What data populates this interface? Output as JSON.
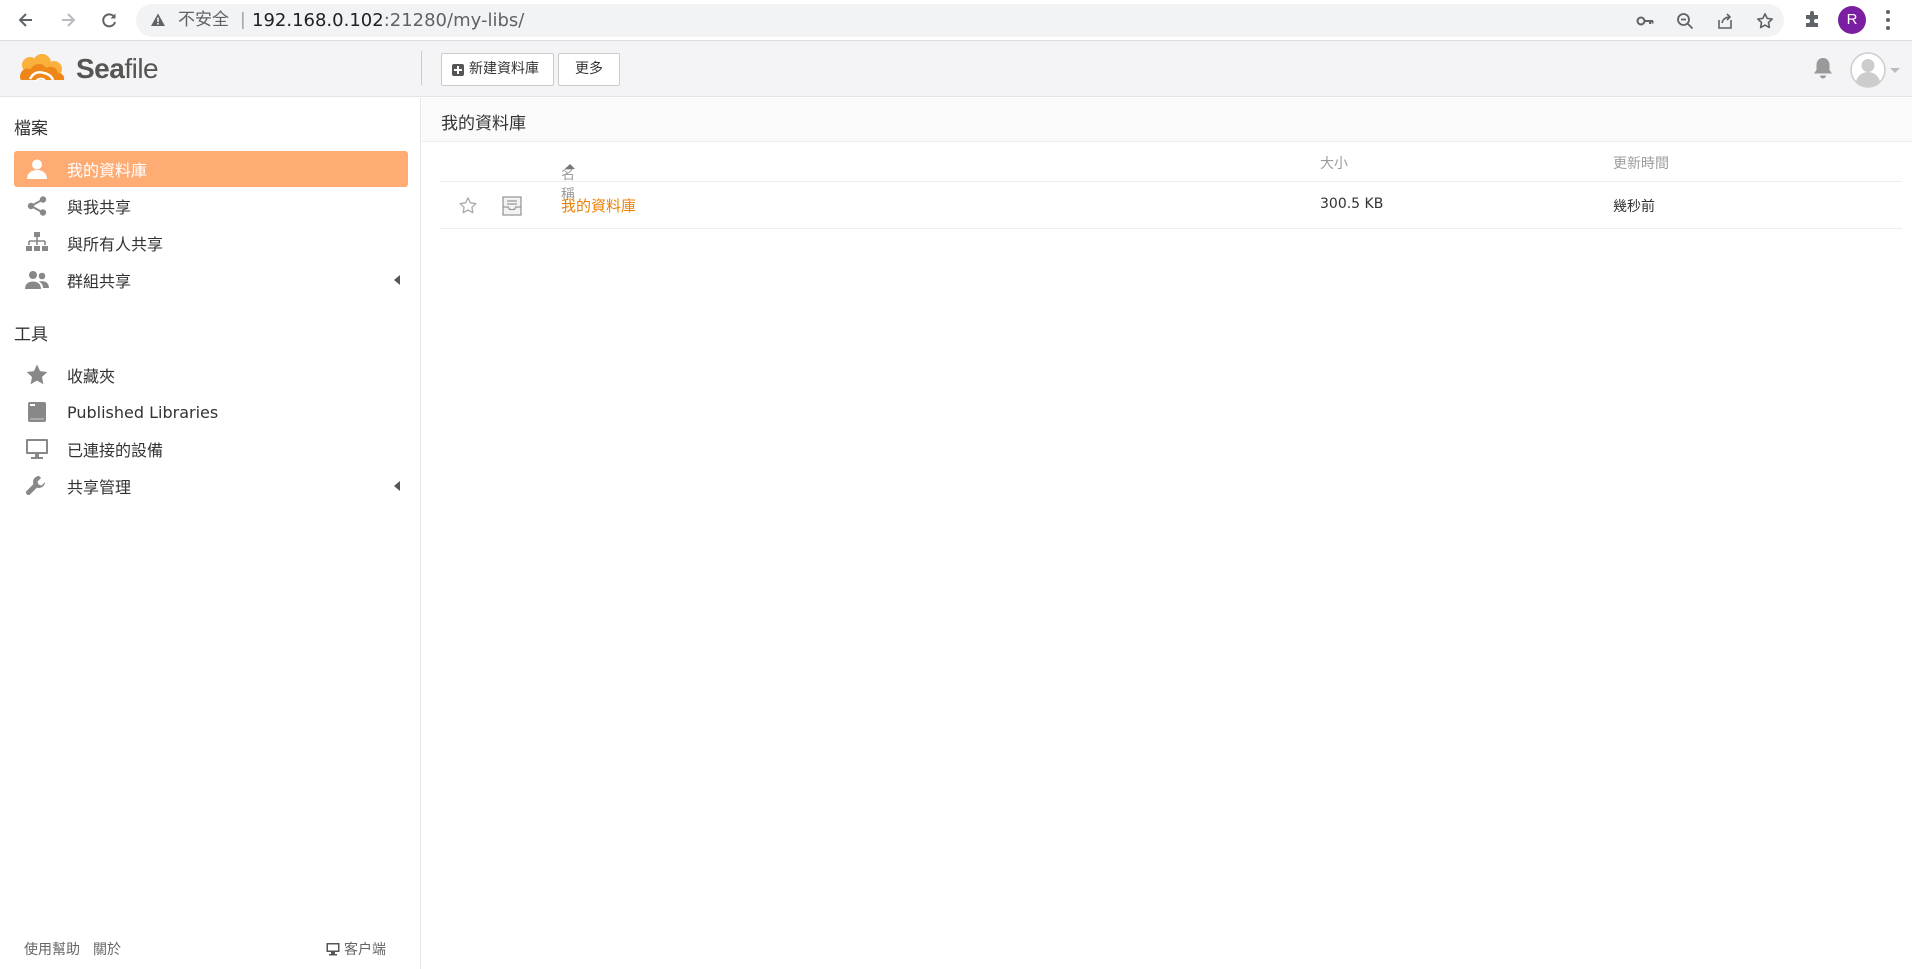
{
  "browser": {
    "security_label": "不安全",
    "separator": "|",
    "url_host": "192.168.0.102",
    "url_rest": ":21280/my-libs/",
    "profile_initial": "R",
    "profile_color": "#7b1fa2"
  },
  "header": {
    "brand_bold": "Sea",
    "brand_rest": "file",
    "new_library_label": "新建資料庫",
    "more_label": "更多"
  },
  "sidebar": {
    "files_heading": "檔案",
    "files_items": [
      {
        "label": "我的資料庫",
        "icon": "user-icon",
        "active": true
      },
      {
        "label": "與我共享",
        "icon": "share-icon",
        "active": false
      },
      {
        "label": "與所有人共享",
        "icon": "org-chart-icon",
        "active": false
      },
      {
        "label": "群組共享",
        "icon": "group-icon",
        "active": false,
        "expandable": true
      }
    ],
    "tools_heading": "工具",
    "tools_items": [
      {
        "label": "收藏夾",
        "icon": "star-icon"
      },
      {
        "label": "Published Libraries",
        "icon": "book-icon"
      },
      {
        "label": "已連接的設備",
        "icon": "monitor-icon"
      },
      {
        "label": "共享管理",
        "icon": "wrench-icon",
        "expandable": true
      }
    ],
    "footer": {
      "help": "使用幫助",
      "about": "關於",
      "client": "客户端"
    }
  },
  "main": {
    "breadcrumb": "我的資料庫",
    "columns": {
      "name": "名稱",
      "size": "大小",
      "mtime": "更新時間"
    },
    "rows": [
      {
        "name": "我的資料庫",
        "size": "300.5 KB",
        "mtime": "幾秒前"
      }
    ]
  },
  "colors": {
    "accent": "#feac74",
    "link": "#eb8205",
    "logo_yellow": "#f9b13b",
    "logo_orange": "#ef8618"
  }
}
